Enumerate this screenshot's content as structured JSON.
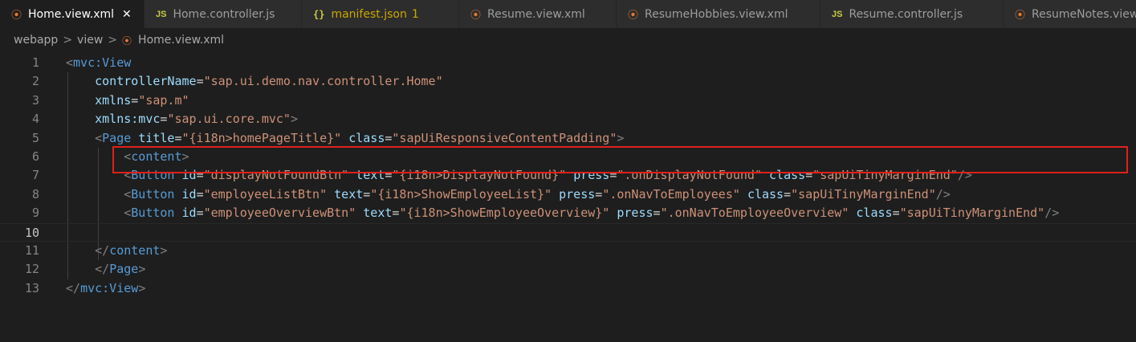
{
  "tabs": [
    {
      "label": "Home.view.xml",
      "icon": "rss-icon",
      "active": true,
      "close": "✕"
    },
    {
      "label": "Home.controller.js",
      "icon": "js-icon",
      "active": false
    },
    {
      "label": "manifest.json",
      "icon": "json-braces-icon",
      "active": false,
      "problems": "1"
    },
    {
      "label": "Resume.view.xml",
      "icon": "rss-icon",
      "active": false
    },
    {
      "label": "ResumeHobbies.view.xml",
      "icon": "rss-icon",
      "active": false
    },
    {
      "label": "Resume.controller.js",
      "icon": "js-icon",
      "active": false
    },
    {
      "label": "ResumeNotes.view.xml",
      "icon": "rss-icon",
      "active": false
    }
  ],
  "icons": {
    "js": "JS",
    "braces": "{}",
    "rss": "⦿"
  },
  "breadcrumb": {
    "items": [
      "webapp",
      "view",
      "Home.view.xml"
    ],
    "separator": ">"
  },
  "editor": {
    "line_numbers": [
      "1",
      "2",
      "3",
      "4",
      "5",
      "6",
      "7",
      "8",
      "9",
      "10",
      "11",
      "12",
      "13"
    ],
    "current_line": "10",
    "lines": [
      {
        "indent": "",
        "tokens": [
          [
            "brk",
            "<"
          ],
          [
            "tag",
            "mvc:View"
          ]
        ]
      },
      {
        "indent": "    ",
        "tokens": [
          [
            "attr",
            "controllerName"
          ],
          [
            "eq",
            "="
          ],
          [
            "str",
            "\"sap.ui.demo.nav.controller.Home\""
          ]
        ]
      },
      {
        "indent": "    ",
        "tokens": [
          [
            "attr",
            "xmlns"
          ],
          [
            "eq",
            "="
          ],
          [
            "str",
            "\"sap.m\""
          ]
        ]
      },
      {
        "indent": "    ",
        "tokens": [
          [
            "attr",
            "xmlns:mvc"
          ],
          [
            "eq",
            "="
          ],
          [
            "str",
            "\"sap.ui.core.mvc\""
          ],
          [
            "brk",
            ">"
          ]
        ]
      },
      {
        "indent": "    ",
        "tokens": [
          [
            "brk",
            "<"
          ],
          [
            "tag",
            "Page"
          ],
          [
            "eq",
            " "
          ],
          [
            "attr",
            "title"
          ],
          [
            "eq",
            "="
          ],
          [
            "str",
            "\"{i18n>homePageTitle}\""
          ],
          [
            "eq",
            " "
          ],
          [
            "attr",
            "class"
          ],
          [
            "eq",
            "="
          ],
          [
            "str",
            "\"sapUiResponsiveContentPadding\""
          ],
          [
            "brk",
            ">"
          ]
        ]
      },
      {
        "indent": "        ",
        "tokens": [
          [
            "brk",
            "<"
          ],
          [
            "tag",
            "content"
          ],
          [
            "brk",
            ">"
          ]
        ]
      },
      {
        "indent": "        ",
        "tokens": [
          [
            "brk",
            "<"
          ],
          [
            "tag",
            "Button"
          ],
          [
            "eq",
            " "
          ],
          [
            "attr",
            "id"
          ],
          [
            "eq",
            "="
          ],
          [
            "str",
            "\"displayNotFoundBtn\""
          ],
          [
            "eq",
            " "
          ],
          [
            "attr",
            "text"
          ],
          [
            "eq",
            "="
          ],
          [
            "str",
            "\"{i18n>DisplayNotFound}\""
          ],
          [
            "eq",
            " "
          ],
          [
            "attr",
            "press"
          ],
          [
            "eq",
            "="
          ],
          [
            "str",
            "\".onDisplayNotFound\""
          ],
          [
            "eq",
            " "
          ],
          [
            "attr",
            "class"
          ],
          [
            "eq",
            "="
          ],
          [
            "str",
            "\"sapUiTinyMarginEnd\""
          ],
          [
            "brk",
            "/>"
          ]
        ]
      },
      {
        "indent": "        ",
        "tokens": [
          [
            "brk",
            "<"
          ],
          [
            "tag",
            "Button"
          ],
          [
            "eq",
            " "
          ],
          [
            "attr",
            "id"
          ],
          [
            "eq",
            "="
          ],
          [
            "str",
            "\"employeeListBtn\""
          ],
          [
            "eq",
            " "
          ],
          [
            "attr",
            "text"
          ],
          [
            "eq",
            "="
          ],
          [
            "str",
            "\"{i18n>ShowEmployeeList}\""
          ],
          [
            "eq",
            " "
          ],
          [
            "attr",
            "press"
          ],
          [
            "eq",
            "="
          ],
          [
            "str",
            "\".onNavToEmployees\""
          ],
          [
            "eq",
            " "
          ],
          [
            "attr",
            "class"
          ],
          [
            "eq",
            "="
          ],
          [
            "str",
            "\"sapUiTinyMarginEnd\""
          ],
          [
            "brk",
            "/>"
          ]
        ]
      },
      {
        "indent": "        ",
        "tokens": [
          [
            "brk",
            "<"
          ],
          [
            "tag",
            "Button"
          ],
          [
            "eq",
            " "
          ],
          [
            "attr",
            "id"
          ],
          [
            "eq",
            "="
          ],
          [
            "str",
            "\"employeeOverviewBtn\""
          ],
          [
            "eq",
            " "
          ],
          [
            "attr",
            "text"
          ],
          [
            "eq",
            "="
          ],
          [
            "str",
            "\"{i18n>ShowEmployeeOverview}\""
          ],
          [
            "eq",
            " "
          ],
          [
            "attr",
            "press"
          ],
          [
            "eq",
            "="
          ],
          [
            "str",
            "\".onNavToEmployeeOverview\""
          ],
          [
            "eq",
            " "
          ],
          [
            "attr",
            "class"
          ],
          [
            "eq",
            "="
          ],
          [
            "str",
            "\"sapUiTinyMarginEnd\""
          ],
          [
            "brk",
            "/>"
          ]
        ]
      },
      {
        "indent": "",
        "tokens": []
      },
      {
        "indent": "    ",
        "tokens": [
          [
            "brk",
            "</"
          ],
          [
            "tag",
            "content"
          ],
          [
            "brk",
            ">"
          ]
        ]
      },
      {
        "indent": "    ",
        "tokens": [
          [
            "brk",
            "</"
          ],
          [
            "tag",
            "Page"
          ],
          [
            "brk",
            ">"
          ]
        ]
      },
      {
        "indent": "",
        "tokens": [
          [
            "brk",
            "</"
          ],
          [
            "tag",
            "mvc:View"
          ],
          [
            "brk",
            ">"
          ]
        ]
      }
    ]
  },
  "colors": {
    "tag": "#569cd6",
    "attr": "#9cdcfe",
    "string": "#ce9178",
    "bracket": "#808080",
    "highlight_box": "#e0201b"
  }
}
